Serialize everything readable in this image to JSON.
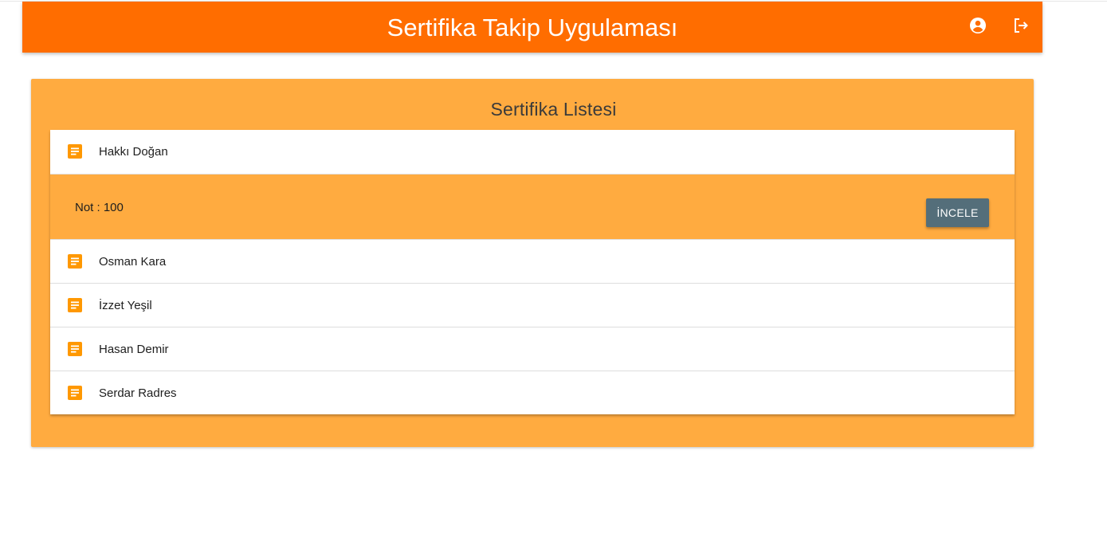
{
  "header": {
    "title": "Sertifika Takip Uygulaması",
    "account_icon": "account-circle-icon",
    "logout_icon": "logout-icon"
  },
  "colors": {
    "appbar": "#ff6d00",
    "panel": "#ffab40",
    "button": "#546e7a"
  },
  "panel": {
    "title": "Sertifika Listesi"
  },
  "list": {
    "item_icon": "document-icon",
    "expanded": {
      "name": "Hakkı Doğan",
      "note": "Not : 100",
      "button_label": "İNCELE"
    },
    "items": [
      {
        "name": "Osman Kara"
      },
      {
        "name": "İzzet Yeşil"
      },
      {
        "name": "Hasan Demir"
      },
      {
        "name": "Serdar Radres"
      }
    ]
  }
}
